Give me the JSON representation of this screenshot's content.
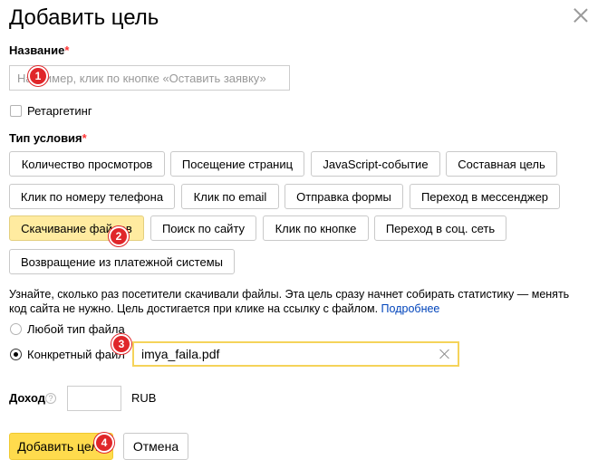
{
  "dialog": {
    "title": "Добавить цель",
    "close_icon": "close-icon"
  },
  "name_field": {
    "label": "Название",
    "required_mark": "*",
    "placeholder": "Например, клик по кнопке «Оставить заявку»",
    "value": ""
  },
  "retargeting": {
    "label": "Ретаргетинг",
    "checked": false
  },
  "condition_type": {
    "label": "Тип условия",
    "required_mark": "*",
    "options": [
      {
        "label": "Количество просмотров",
        "active": false
      },
      {
        "label": "Посещение страниц",
        "active": false
      },
      {
        "label": "JavaScript-событие",
        "active": false
      },
      {
        "label": "Составная цель",
        "active": false
      },
      {
        "label": "Клик по номеру телефона",
        "active": false
      },
      {
        "label": "Клик по email",
        "active": false
      },
      {
        "label": "Отправка формы",
        "active": false
      },
      {
        "label": "Переход в мессенджер",
        "active": false
      },
      {
        "label": "Скачивание файлов",
        "active": true
      },
      {
        "label": "Поиск по сайту",
        "active": false
      },
      {
        "label": "Клик по кнопке",
        "active": false
      },
      {
        "label": "Переход в соц. сеть",
        "active": false
      },
      {
        "label": "Возвращение из платежной системы",
        "active": false
      }
    ]
  },
  "description": {
    "text": "Узнайте, сколько раз посетители скачивали файлы. Эта цель сразу начнет собирать статистику — менять код сайта не нужно. Цель достигается при клике на ссылку с файлом. ",
    "link": "Подробнее"
  },
  "file_type": {
    "any_label": "Любой тип файла",
    "any_checked": false,
    "specific_label": "Конкретный файл",
    "specific_checked": true,
    "specific_value": "imya_faila.pdf"
  },
  "income": {
    "label": "Доход",
    "help_icon": "question-icon",
    "value": "",
    "currency": "RUB"
  },
  "actions": {
    "add_label": "Добавить цель",
    "cancel_label": "Отмена"
  },
  "markers": [
    "1",
    "2",
    "3",
    "4"
  ]
}
